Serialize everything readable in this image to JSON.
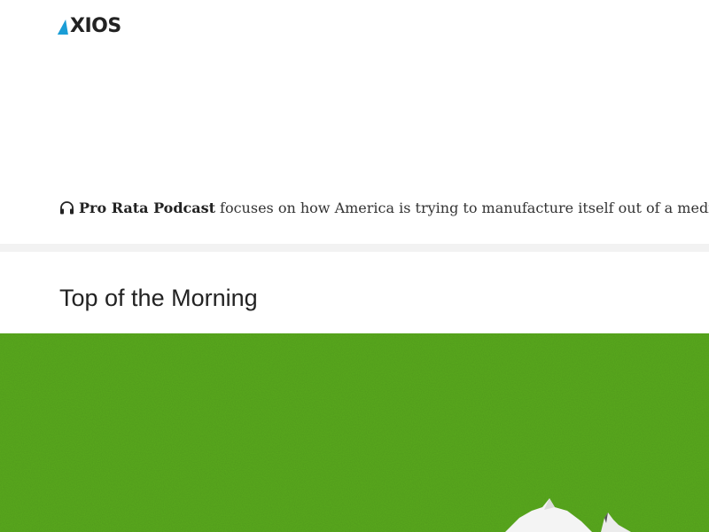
{
  "header": {
    "logo_text": "XIOS",
    "logo_full": "AXIOS",
    "brand_color": "#1a9dd6"
  },
  "podcast": {
    "icon": "headphones-icon",
    "name": "Pro Rata Podcast",
    "text": "focuses on how America is trying to manufacture itself out of a medical su"
  },
  "section": {
    "title": "Top of the Morning"
  },
  "hero": {
    "background_color": "#5aab1e",
    "alt": "illustration"
  }
}
